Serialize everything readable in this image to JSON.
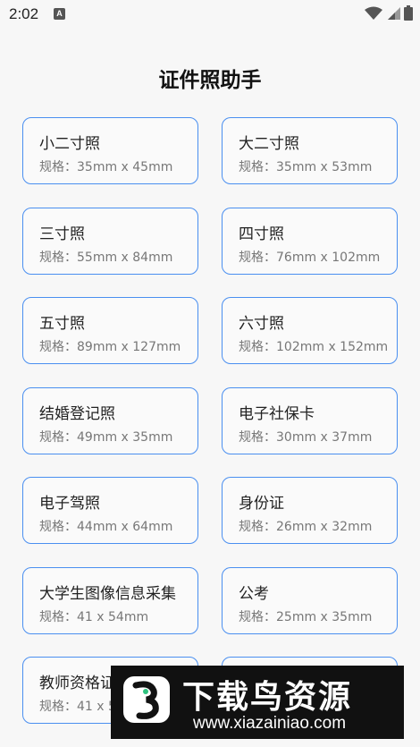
{
  "status_bar": {
    "time": "2:02",
    "notification_icon_letter": "A",
    "icons": [
      "wifi-icon",
      "signal-icon",
      "battery-icon"
    ]
  },
  "app": {
    "title": "证件照助手"
  },
  "photo_types": [
    {
      "name": "小二寸照",
      "spec": "规格：35mm x 45mm"
    },
    {
      "name": "大二寸照",
      "spec": "规格：35mm x 53mm"
    },
    {
      "name": "三寸照",
      "spec": "规格：55mm x 84mm"
    },
    {
      "name": "四寸照",
      "spec": "规格：76mm x 102mm"
    },
    {
      "name": "五寸照",
      "spec": "规格：89mm x 127mm"
    },
    {
      "name": "六寸照",
      "spec": "规格：102mm x 152mm"
    },
    {
      "name": "结婚登记照",
      "spec": "规格：49mm x 35mm"
    },
    {
      "name": "电子社保卡",
      "spec": "规格：30mm x 37mm"
    },
    {
      "name": "电子驾照",
      "spec": "规格：44mm x 64mm"
    },
    {
      "name": "身份证",
      "spec": "规格：26mm x 32mm"
    },
    {
      "name": "大学生图像信息采集",
      "spec": "规格：41 x 54mm"
    },
    {
      "name": "公考",
      "spec": "规格：25mm x 35mm"
    },
    {
      "name": "教师资格证",
      "spec": "规格：41 x 54mm"
    },
    {
      "name": "",
      "spec": ""
    }
  ],
  "watermark": {
    "title": "下载鸟资源",
    "url": "www.xiazainiao.com"
  },
  "colors": {
    "card_border": "#4a8ff0",
    "background": "#f7f7f7"
  }
}
